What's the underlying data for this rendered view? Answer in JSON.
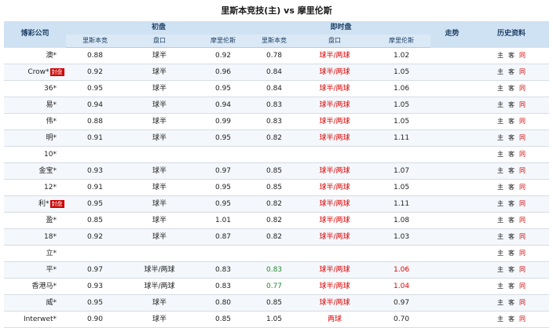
{
  "title": "里斯本竞技(主) vs 摩里伦斯",
  "headers": {
    "company": "博彩公司",
    "initial": "初盘",
    "live": "即时盘",
    "trend": "走势",
    "history": "历史资料",
    "home": "里斯本竞",
    "handicap": "盘口",
    "away": "摩里伦斯"
  },
  "hist_labels": {
    "home": "主",
    "away": "客",
    "same": "同"
  },
  "rows": [
    {
      "company": "澳*",
      "badge": "",
      "init_home": "0.88",
      "init_line": "球半",
      "init_away": "0.92",
      "live_home": "0.78",
      "live_line": "球半/两球",
      "live_away": "1.02",
      "lh_class": "",
      "la_class": ""
    },
    {
      "company": "Crow*",
      "badge": "封盘",
      "init_home": "0.92",
      "init_line": "球半",
      "init_away": "0.96",
      "live_home": "0.84",
      "live_line": "球半/两球",
      "live_away": "1.05",
      "lh_class": "",
      "la_class": ""
    },
    {
      "company": "36*",
      "badge": "",
      "init_home": "0.95",
      "init_line": "球半",
      "init_away": "0.95",
      "live_home": "0.84",
      "live_line": "球半/两球",
      "live_away": "1.06",
      "lh_class": "",
      "la_class": ""
    },
    {
      "company": "易*",
      "badge": "",
      "init_home": "0.94",
      "init_line": "球半",
      "init_away": "0.94",
      "live_home": "0.83",
      "live_line": "球半/两球",
      "live_away": "1.05",
      "lh_class": "",
      "la_class": ""
    },
    {
      "company": "伟*",
      "badge": "",
      "init_home": "0.88",
      "init_line": "球半",
      "init_away": "0.99",
      "live_home": "0.83",
      "live_line": "球半/两球",
      "live_away": "1.05",
      "lh_class": "",
      "la_class": ""
    },
    {
      "company": "明*",
      "badge": "",
      "init_home": "0.91",
      "init_line": "球半",
      "init_away": "0.95",
      "live_home": "0.82",
      "live_line": "球半/两球",
      "live_away": "1.11",
      "lh_class": "",
      "la_class": ""
    },
    {
      "company": "10*",
      "badge": "",
      "init_home": "",
      "init_line": "",
      "init_away": "",
      "live_home": "",
      "live_line": "",
      "live_away": "",
      "lh_class": "",
      "la_class": ""
    },
    {
      "company": "金宝*",
      "badge": "",
      "init_home": "0.93",
      "init_line": "球半",
      "init_away": "0.97",
      "live_home": "0.85",
      "live_line": "球半/两球",
      "live_away": "1.07",
      "lh_class": "",
      "la_class": ""
    },
    {
      "company": "12*",
      "badge": "",
      "init_home": "0.91",
      "init_line": "球半",
      "init_away": "0.95",
      "live_home": "0.85",
      "live_line": "球半/两球",
      "live_away": "1.05",
      "lh_class": "",
      "la_class": ""
    },
    {
      "company": "利*",
      "badge": "封盘",
      "init_home": "0.95",
      "init_line": "球半",
      "init_away": "0.95",
      "live_home": "0.82",
      "live_line": "球半/两球",
      "live_away": "1.11",
      "lh_class": "",
      "la_class": ""
    },
    {
      "company": "盈*",
      "badge": "",
      "init_home": "0.85",
      "init_line": "球半",
      "init_away": "1.01",
      "live_home": "0.82",
      "live_line": "球半/两球",
      "live_away": "1.08",
      "lh_class": "",
      "la_class": ""
    },
    {
      "company": "18*",
      "badge": "",
      "init_home": "0.92",
      "init_line": "球半",
      "init_away": "0.87",
      "live_home": "0.82",
      "live_line": "球半/两球",
      "live_away": "1.03",
      "lh_class": "",
      "la_class": ""
    },
    {
      "company": "立*",
      "badge": "",
      "init_home": "",
      "init_line": "",
      "init_away": "",
      "live_home": "",
      "live_line": "",
      "live_away": "",
      "lh_class": "",
      "la_class": ""
    },
    {
      "company": "平*",
      "badge": "",
      "init_home": "0.97",
      "init_line": "球半/两球",
      "init_away": "0.83",
      "live_home": "0.83",
      "live_line": "球半/两球",
      "live_away": "1.06",
      "lh_class": "green",
      "la_class": "red"
    },
    {
      "company": "香港马*",
      "badge": "",
      "init_home": "0.93",
      "init_line": "球半/两球",
      "init_away": "0.83",
      "live_home": "0.77",
      "live_line": "球半/两球",
      "live_away": "1.04",
      "lh_class": "green",
      "la_class": "red"
    },
    {
      "company": "威*",
      "badge": "",
      "init_home": "0.95",
      "init_line": "球半",
      "init_away": "0.80",
      "live_home": "0.85",
      "live_line": "球半/两球",
      "live_away": "0.97",
      "lh_class": "",
      "la_class": ""
    },
    {
      "company": "Interwet*",
      "badge": "",
      "init_home": "0.90",
      "init_line": "球半",
      "init_away": "0.85",
      "live_home": "1.05",
      "live_line": "两球",
      "live_away": "0.70",
      "lh_class": "",
      "la_class": ""
    }
  ],
  "colors": {
    "header_bg": "#cfe2f3",
    "subheader_bg": "#dbe9f6",
    "live_line": "#dd0000",
    "badge_bg": "#cc0000",
    "down": "#1f8a2e",
    "up": "#dd0000"
  }
}
